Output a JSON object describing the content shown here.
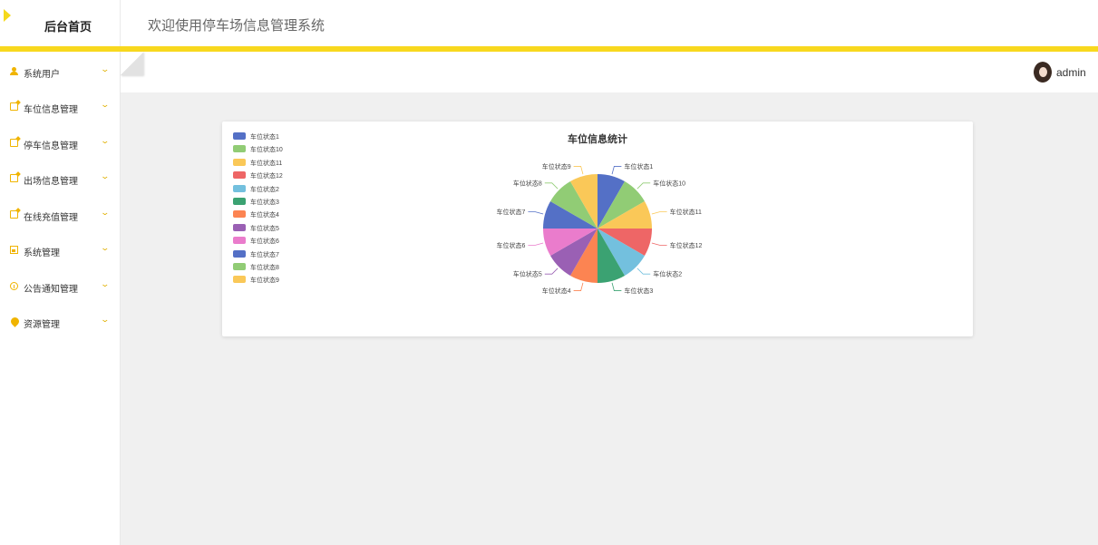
{
  "header": {
    "home_label": "后台首页",
    "welcome": "欢迎使用停车场信息管理系统"
  },
  "sidebar": {
    "items": [
      {
        "label": "系统用户",
        "icon": "user-icon"
      },
      {
        "label": "车位信息管理",
        "icon": "edit-icon"
      },
      {
        "label": "停车信息管理",
        "icon": "edit-icon"
      },
      {
        "label": "出场信息管理",
        "icon": "edit-icon"
      },
      {
        "label": "在线充值管理",
        "icon": "edit-icon"
      },
      {
        "label": "系统管理",
        "icon": "image-icon"
      },
      {
        "label": "公告通知管理",
        "icon": "info-icon"
      },
      {
        "label": "资源管理",
        "icon": "pin-icon"
      }
    ]
  },
  "user": {
    "name": "admin"
  },
  "colors": {
    "accent": "#f8d81e",
    "icon": "#f0b400"
  },
  "chart_data": {
    "type": "pie",
    "title": "车位信息统计",
    "legend_position": "top-left",
    "categories": [
      "车位状态1",
      "车位状态10",
      "车位状态11",
      "车位状态12",
      "车位状态2",
      "车位状态3",
      "车位状态4",
      "车位状态5",
      "车位状态6",
      "车位状态7",
      "车位状态8",
      "车位状态9"
    ],
    "values": [
      1,
      1,
      1,
      1,
      1,
      1,
      1,
      1,
      1,
      1,
      1,
      1
    ],
    "colors": [
      "#5470c6",
      "#91cc75",
      "#fac858",
      "#ee6666",
      "#73c0de",
      "#3ba272",
      "#fc8452",
      "#9a60b4",
      "#ea7ccc",
      "#5470c6",
      "#91cc75",
      "#fac858"
    ]
  }
}
